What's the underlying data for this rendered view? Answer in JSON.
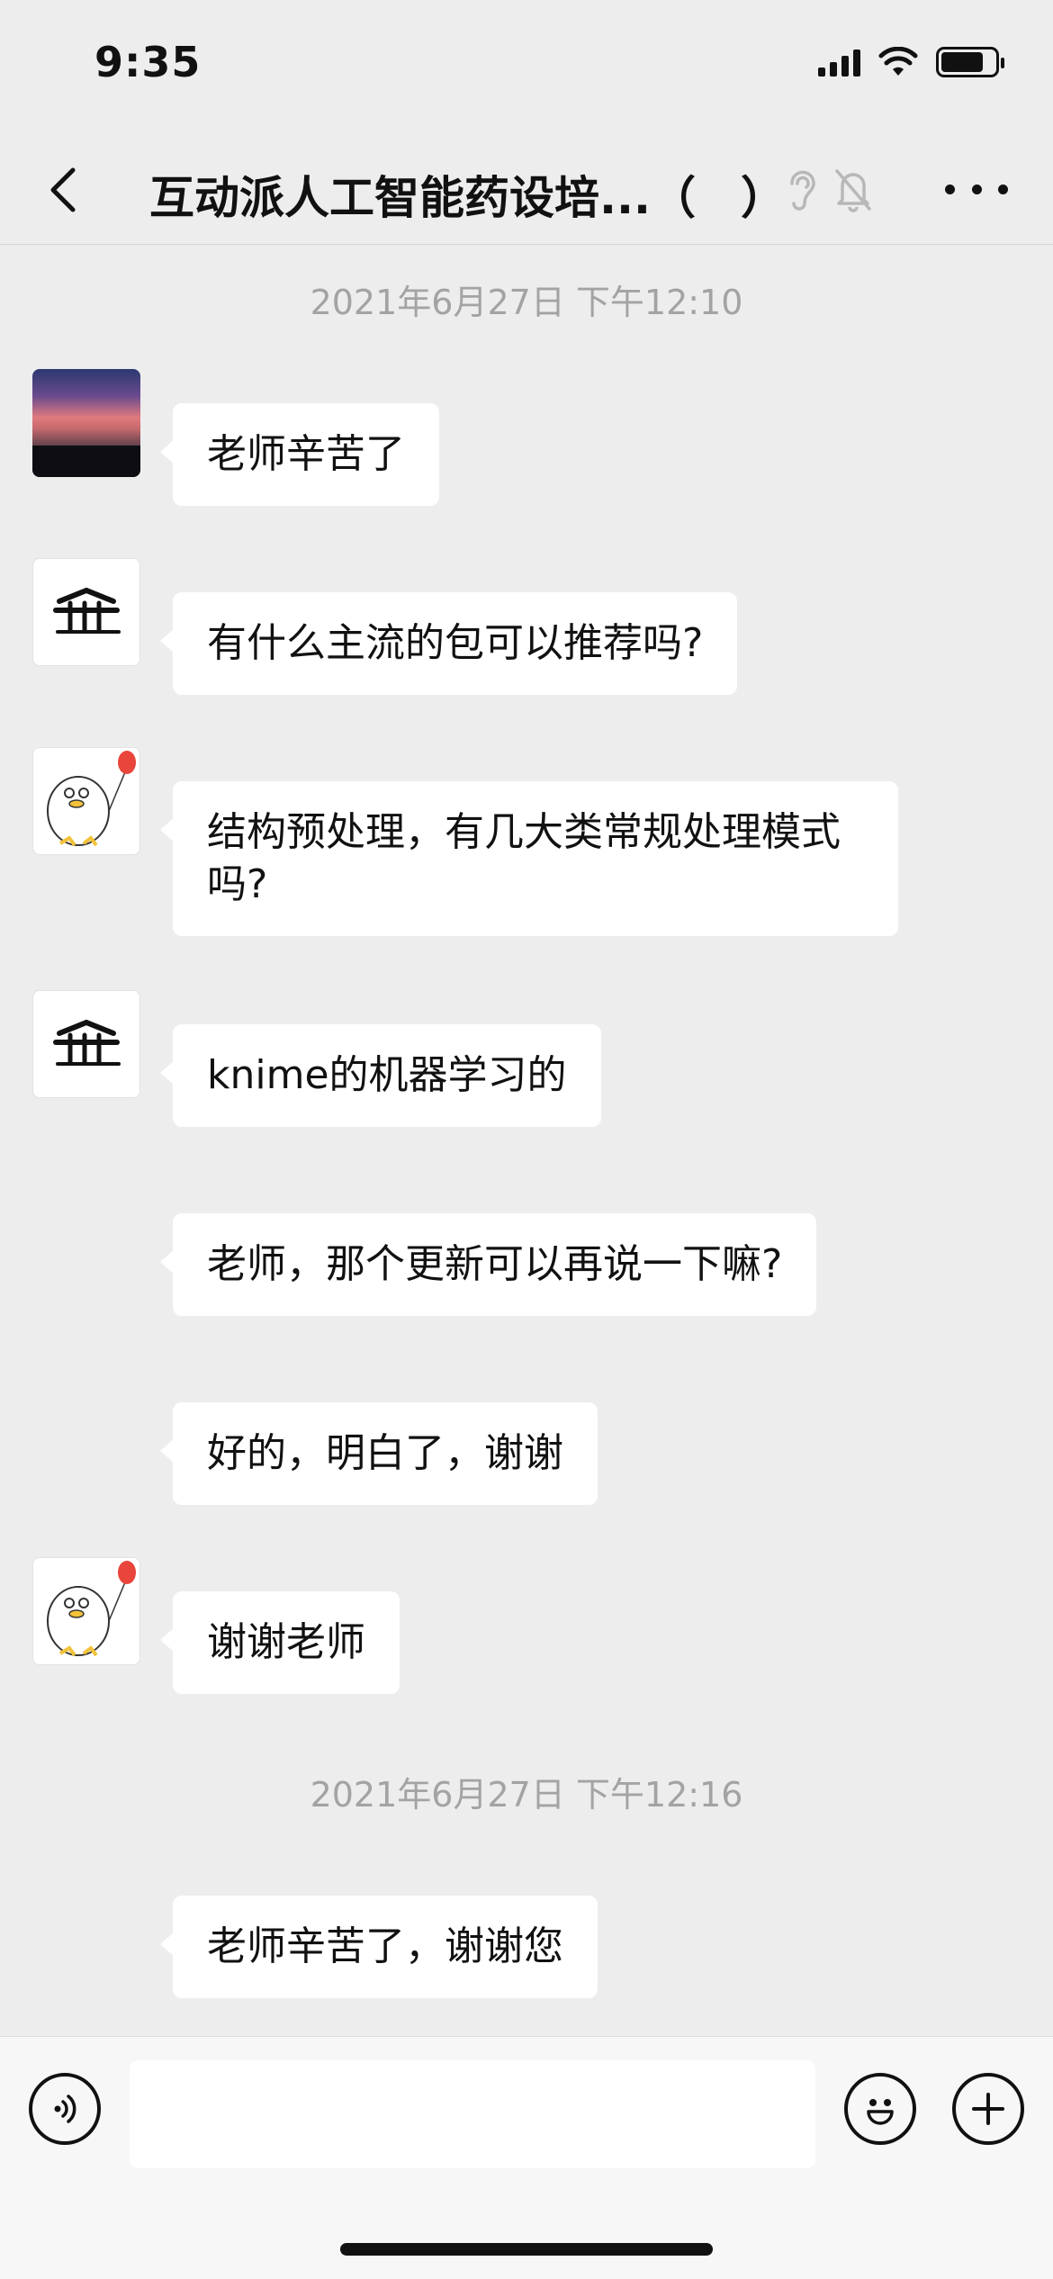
{
  "status_bar": {
    "time": "9:35"
  },
  "nav": {
    "title": "互动派人工智能药设培...（　）",
    "back_icon": "chevron-left-icon",
    "more_icon": "more-dots-icon"
  },
  "timestamps": [
    "2021年6月27日 下午12:10",
    "2021年6月27日 下午12:16"
  ],
  "messages": [
    {
      "avatar": "sunset-photo",
      "text": "老师辛苦了"
    },
    {
      "avatar": "calligraphy",
      "text": "有什么主流的包可以推荐吗?"
    },
    {
      "avatar": "duck-balloon",
      "text": "结构预处理，有几大类常规处理模式吗?"
    },
    {
      "avatar": "calligraphy",
      "text": "knime的机器学习的"
    },
    {
      "avatar": "none",
      "text": "老师，那个更新可以再说一下嘛?"
    },
    {
      "avatar": "none",
      "text": "好的，明白了，谢谢"
    },
    {
      "avatar": "duck-balloon",
      "text": "谢谢老师"
    },
    {
      "avatar": "none",
      "text": "老师辛苦了，谢谢您"
    }
  ],
  "input_bar": {
    "placeholder": "",
    "voice_icon": "voice-icon",
    "emoji_icon": "emoji-icon",
    "plus_icon": "plus-icon"
  }
}
